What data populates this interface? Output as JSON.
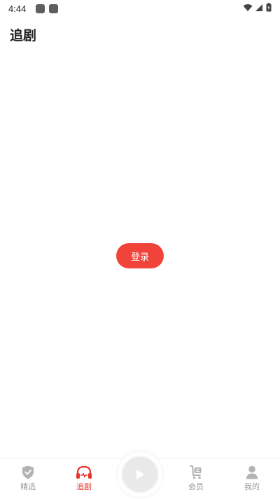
{
  "status_bar": {
    "time": "4:44",
    "icons": [
      "notification-square-icon",
      "notification-square-icon",
      "wifi-icon",
      "signal-icon",
      "battery-icon"
    ]
  },
  "header": {
    "title": "追剧"
  },
  "main": {
    "login_label": "登录"
  },
  "bottom_nav": {
    "items": [
      {
        "label": "精选",
        "icon": "shield-check-icon"
      },
      {
        "label": "追剧",
        "icon": "headphones-icon"
      },
      {
        "label": "",
        "icon": "play-icon"
      },
      {
        "label": "会员",
        "icon": "cart-icon"
      },
      {
        "label": "我的",
        "icon": "person-icon"
      }
    ],
    "active_index": 1
  },
  "colors": {
    "accent": "#f0443a",
    "active_tab": "#e8352b",
    "inactive_tab": "#9a9a9a"
  }
}
